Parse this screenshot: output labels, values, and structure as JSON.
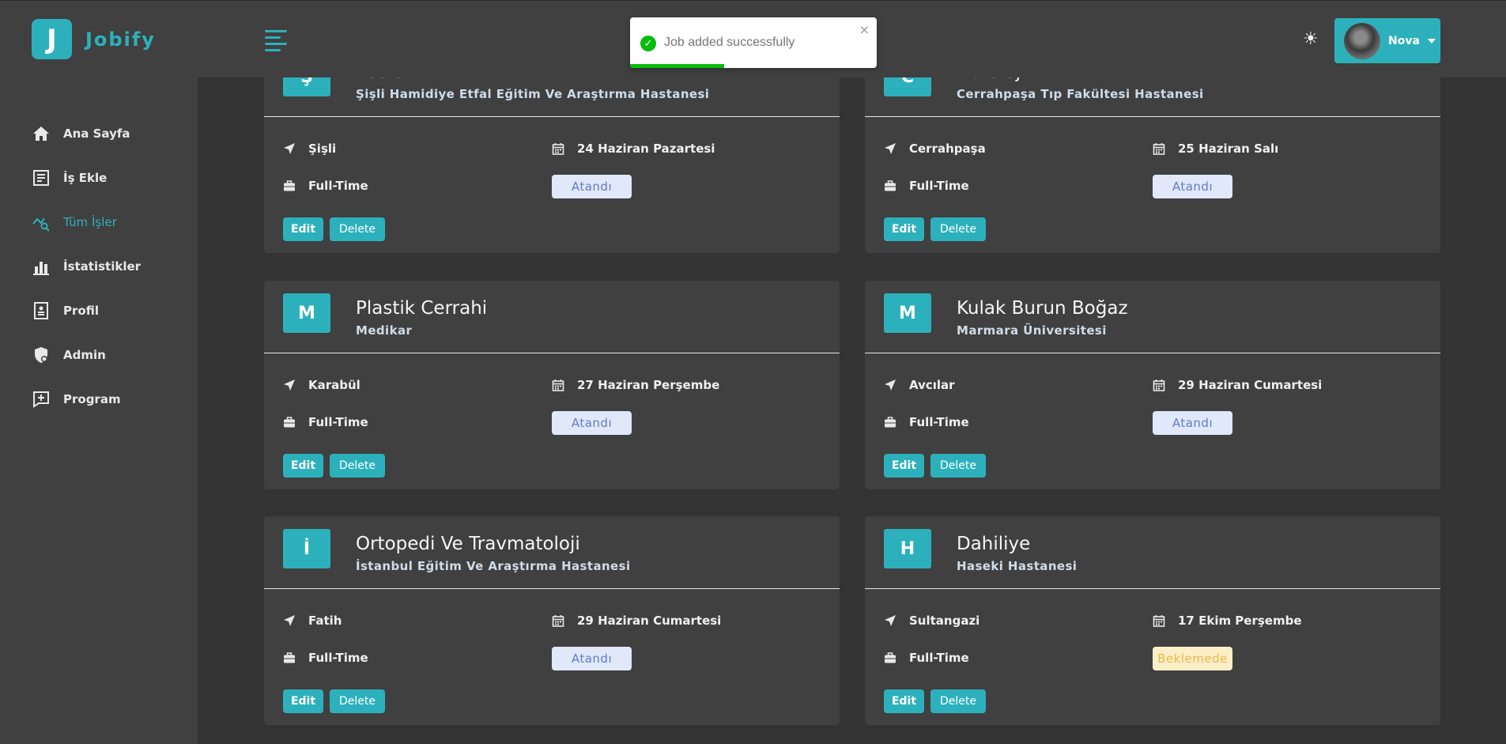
{
  "brand": {
    "letter": "J",
    "name": "Jobify"
  },
  "sidebar": {
    "items": [
      {
        "label": "Ana Sayfa",
        "icon": "home-icon"
      },
      {
        "label": "İş Ekle",
        "icon": "add-job-icon"
      },
      {
        "label": "Tüm İşler",
        "icon": "all-jobs-icon",
        "active": true
      },
      {
        "label": "İstatistikler",
        "icon": "stats-icon"
      },
      {
        "label": "Profil",
        "icon": "profile-icon"
      },
      {
        "label": "Admin",
        "icon": "admin-icon"
      },
      {
        "label": "Program",
        "icon": "program-icon"
      }
    ]
  },
  "header": {
    "theme_icon": "☀",
    "user_name": "Nova"
  },
  "toast": {
    "message": "Job added successfully",
    "close": "×",
    "progress": 0.38
  },
  "jobs": [
    {
      "letter": "Ş",
      "title": "Pediatri",
      "company": "Şişli Hamidiye Etfal Eğitim Ve Araştırma Hastanesi",
      "location": "Şişli",
      "date": "24 Haziran Pazartesi",
      "type": "Full-Time",
      "status": "Atandı"
    },
    {
      "letter": "C",
      "title": "Nöroloji",
      "company": "Cerrahpaşa Tıp Fakültesi Hastanesi",
      "location": "Cerrahpaşa",
      "date": "25 Haziran Salı",
      "type": "Full-Time",
      "status": "Atandı"
    },
    {
      "letter": "M",
      "title": "Plastik Cerrahi",
      "company": "Medikar",
      "location": "Karabül",
      "date": "27 Haziran Perşembe",
      "type": "Full-Time",
      "status": "Atandı"
    },
    {
      "letter": "M",
      "title": "Kulak Burun Boğaz",
      "company": "Marmara Üniversitesi",
      "location": "Avcılar",
      "date": "29 Haziran Cumartesi",
      "type": "Full-Time",
      "status": "Atandı"
    },
    {
      "letter": "İ",
      "title": "Ortopedi Ve Travmatoloji",
      "company": "İstanbul Eğitim Ve Araştırma Hastanesi",
      "location": "Fatih",
      "date": "29 Haziran Cumartesi",
      "type": "Full-Time",
      "status": "Atandı"
    },
    {
      "letter": "H",
      "title": "Dahiliye",
      "company": "Haseki Hastanesi",
      "location": "Sultangazi",
      "date": "17 Ekim Perşembe",
      "type": "Full-Time",
      "status": "Beklemede",
      "pending": true
    }
  ],
  "actions": {
    "edit": "Edit",
    "delete": "Delete"
  },
  "colors": {
    "accent": "#2cb1bc",
    "background": "#333333",
    "panel": "#404040",
    "toast_success": "#07bc0c"
  }
}
